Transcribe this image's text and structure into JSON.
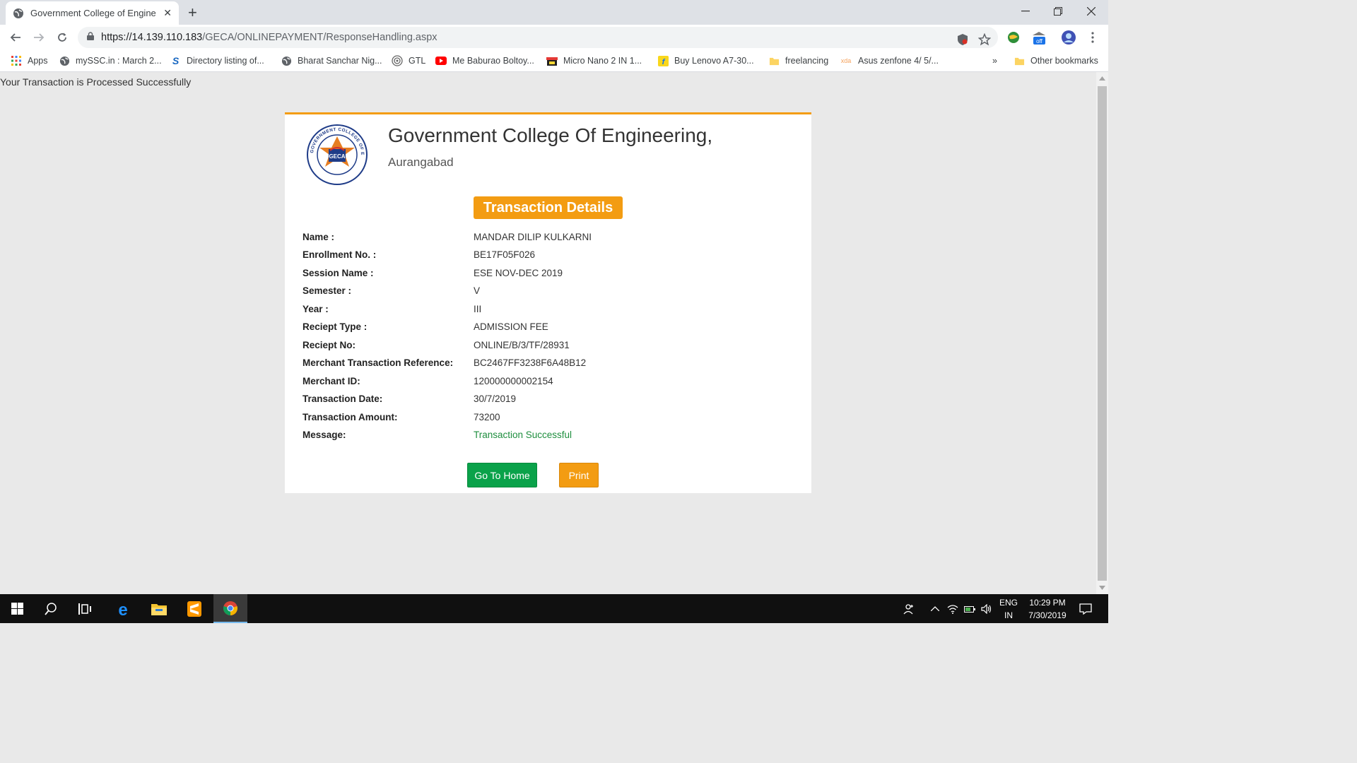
{
  "browser": {
    "tab_title": "Government College of Engineer",
    "url_host": "https://14.139.110.183",
    "url_path": "/GECA/ONLINEPAYMENT/ResponseHandling.aspx",
    "extension_badge": "off"
  },
  "bookmarks": {
    "items": [
      {
        "label": "Apps",
        "icon": "apps-grid-icon"
      },
      {
        "label": "mySSC.in : March 2...",
        "icon": "globe-icon"
      },
      {
        "label": "Directory listing of...",
        "icon": "s-logo-icon"
      },
      {
        "label": "Bharat Sanchar Nig...",
        "icon": "globe-icon"
      },
      {
        "label": "GTL",
        "icon": "gtl-icon"
      },
      {
        "label": "Me Baburao Boltoy...",
        "icon": "youtube-icon"
      },
      {
        "label": "Micro Nano 2 IN 1...",
        "icon": "shop-icon"
      },
      {
        "label": "Buy Lenovo A7-30...",
        "icon": "flipkart-icon"
      },
      {
        "label": "freelancing",
        "icon": "folder-icon"
      },
      {
        "label": "Asus zenfone 4/ 5/...",
        "icon": "xda-icon"
      }
    ],
    "overflow": "»",
    "other": "Other bookmarks",
    "xda_text": "xda"
  },
  "page": {
    "status_message": "Your Transaction is Processed Successfully",
    "college_name": "Government College Of Engineering,",
    "college_city": "Aurangabad",
    "logo_text": "GECA",
    "logo_ring_text": "GOVERNMENT COLLEGE OF ENGINEERING AURANGABAD",
    "heading": "Transaction Details",
    "rows": [
      {
        "label": "Name :",
        "value": "MANDAR DILIP KULKARNI"
      },
      {
        "label": "Enrollment No. :",
        "value": "BE17F05F026"
      },
      {
        "label": "Session Name :",
        "value": "ESE NOV-DEC 2019"
      },
      {
        "label": "Semester :",
        "value": "V"
      },
      {
        "label": "Year :",
        "value": "III"
      },
      {
        "label": "Reciept Type :",
        "value": "ADMISSION FEE"
      },
      {
        "label": "Reciept No:",
        "value": "ONLINE/B/3/TF/28931"
      },
      {
        "label": "Merchant Transaction Reference:",
        "value": "BC2467FF3238F6A48B12"
      },
      {
        "label": "Merchant ID:",
        "value": "120000000002154"
      },
      {
        "label": "Transaction Date:",
        "value": "30/7/2019"
      },
      {
        "label": "Transaction Amount:",
        "value": "73200"
      },
      {
        "label": "Message:",
        "value": "Transaction Successful"
      }
    ],
    "home_button": "Go To Home",
    "print_button": "Print",
    "colors": {
      "accent": "#f39c12",
      "success": "#0aa24a",
      "message": "#1e8e3e"
    }
  },
  "taskbar": {
    "language": "ENG",
    "region": "IN",
    "time": "10:29 PM",
    "date": "7/30/2019"
  }
}
